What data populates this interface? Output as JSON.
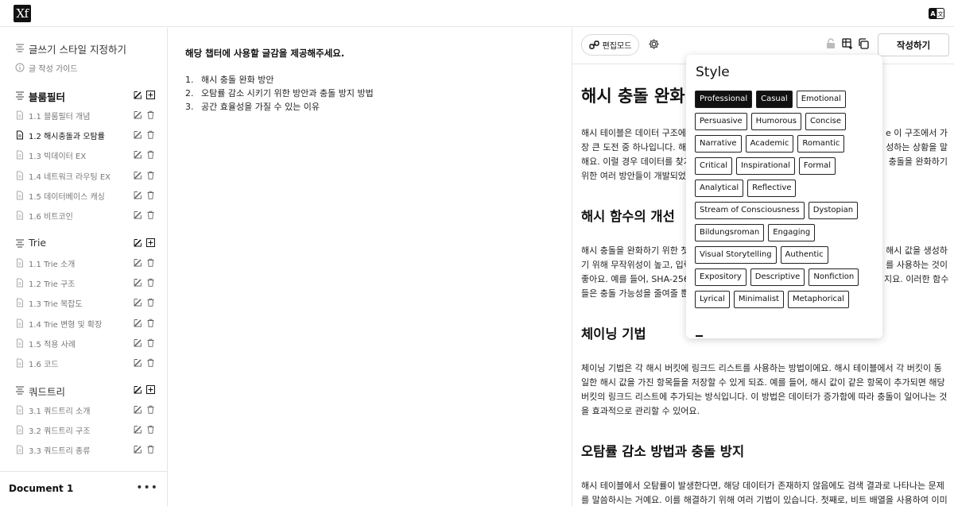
{
  "app": {
    "logo_text": "Xf",
    "translate_icon": "translate-icon"
  },
  "sidebar": {
    "top_items": [
      {
        "label": "글쓰기 스타일 지정하기",
        "icon": "align-lines-icon"
      },
      {
        "label": "글 작성 가이드",
        "icon": "info-icon"
      }
    ],
    "sections": [
      {
        "title": "블룸필터",
        "bold": true,
        "items": [
          "1.1 블룸필터 개념",
          "1.2 해시충돌과 오탐률",
          "1.3 빅데이터 EX",
          "1.4 네트워크 라우팅 EX",
          "1.5 데이터베이스 캐싱",
          "1.6 비트코인"
        ],
        "active_index": 1
      },
      {
        "title": "Trie",
        "bold": false,
        "items": [
          "1.1 Trie 소개",
          "1.2 Trie 구조",
          "1.3 Trie 복잡도",
          "1.4 Trie 변형 및 확장",
          "1.5 적용 사례",
          "1.6 코드"
        ],
        "active_index": -1
      },
      {
        "title": "쿼드트리",
        "bold": false,
        "items": [
          "3.1 쿼드트리 소개",
          "3.2 쿼드트리 구조",
          "3.3 쿼드트리 종류"
        ],
        "active_index": -1
      }
    ],
    "document_title": "Document 1",
    "more_label": "•••"
  },
  "middle": {
    "prompt": "해당 챕터에 사용할 글감을 제공해주세요.",
    "items": [
      {
        "num": "1.",
        "text": "해시 충돌 완화 방안"
      },
      {
        "num": "2.",
        "text": "오탐률 감소 시키기 위한 방안과 충돌 방지 방법"
      },
      {
        "num": "3.",
        "text": "공간 효율성을 가질 수 있는 이유"
      }
    ]
  },
  "toolbar": {
    "edit_mode_label": "편집모드",
    "write_label": "작성하기"
  },
  "doc": {
    "h1": "해시 충돌 완화",
    "p1": [
      "해시 테이블은 데이터 구조에",
      "장 큰 도전 중 하나입니다. 해시",
      "해요. 이럴 경우 데이터를 찾거",
      "위한 여러 방안들이 개발되었"
    ],
    "p1_right": [
      "e 이 구조에서 가",
      "성하는 상황을 말",
      "충돌을 완화하기",
      ""
    ],
    "h2a": "해시 함수의 개선",
    "p2": [
      "해시 충돌을 완화하기 위한 첫",
      "기 위해 무작위성이 높고, 입력",
      "좋아요. 예를 들어, SHA-256과",
      "들은 충돌 가능성을 줄여줄 뿐"
    ],
    "p2_right": [
      "해시 값을 생성하",
      "를 사용하는 것이",
      "지요. 이러한 함수",
      ""
    ],
    "h2b": "체이닝 기법",
    "p3": [
      "체이닝 기법은 각 해시 버킷에 링크드 리스트를 사용하는 방법이에요. 해시 테이블에서 각 버킷이 동",
      "일한 해시 값을 가진 항목들을 저장할 수 있게 되죠. 예를 들어, 해시 값이 같은 항목이 추가되면 해당",
      "버킷의 링크드 리스트에 추가되는 방식입니다. 이 방법은 데이터가 증가함에 따라 충돌이 일어나는 것",
      "을 효과적으로 관리할 수 있어요."
    ],
    "h2c": "오탐률 감소 방법과 충돌 방지",
    "p4": [
      "해시 테이블에서 오탐률이 발생한다면, 해당 데이터가 존재하지 않음에도 검색 결과로 나타나는 문제",
      "를 말씀하시는 거예요. 이를 해결하기 위해 여러 기법이 있습니다. 첫째로, 비트 배열을 사용하여 이미"
    ]
  },
  "style_popup": {
    "title": "Style",
    "chips": [
      {
        "label": "Professional",
        "selected": true
      },
      {
        "label": "Casual",
        "selected": true
      },
      {
        "label": "Emotional",
        "selected": false
      },
      {
        "label": "Persuasive",
        "selected": false
      },
      {
        "label": "Humorous",
        "selected": false
      },
      {
        "label": "Concise",
        "selected": false
      },
      {
        "label": "Narrative",
        "selected": false
      },
      {
        "label": "Academic",
        "selected": false
      },
      {
        "label": "Romantic",
        "selected": false
      },
      {
        "label": "Critical",
        "selected": false
      },
      {
        "label": "Inspirational",
        "selected": false
      },
      {
        "label": "Formal",
        "selected": false
      },
      {
        "label": "Analytical",
        "selected": false
      },
      {
        "label": "Reflective",
        "selected": false
      },
      {
        "label": "Stream of Consciousness",
        "selected": false
      },
      {
        "label": "Dystopian",
        "selected": false
      },
      {
        "label": "Bildungsroman",
        "selected": false
      },
      {
        "label": "Engaging",
        "selected": false
      },
      {
        "label": "Visual Storytelling",
        "selected": false
      },
      {
        "label": "Authentic",
        "selected": false
      },
      {
        "label": "Expository",
        "selected": false
      },
      {
        "label": "Descriptive",
        "selected": false
      },
      {
        "label": "Nonfiction",
        "selected": false
      },
      {
        "label": "Lyrical",
        "selected": false
      },
      {
        "label": "Minimalist",
        "selected": false
      },
      {
        "label": "Metaphorical",
        "selected": false
      }
    ]
  },
  "colors": {
    "selected_chip_bg": "#111111",
    "border": "#e5e5e5"
  }
}
